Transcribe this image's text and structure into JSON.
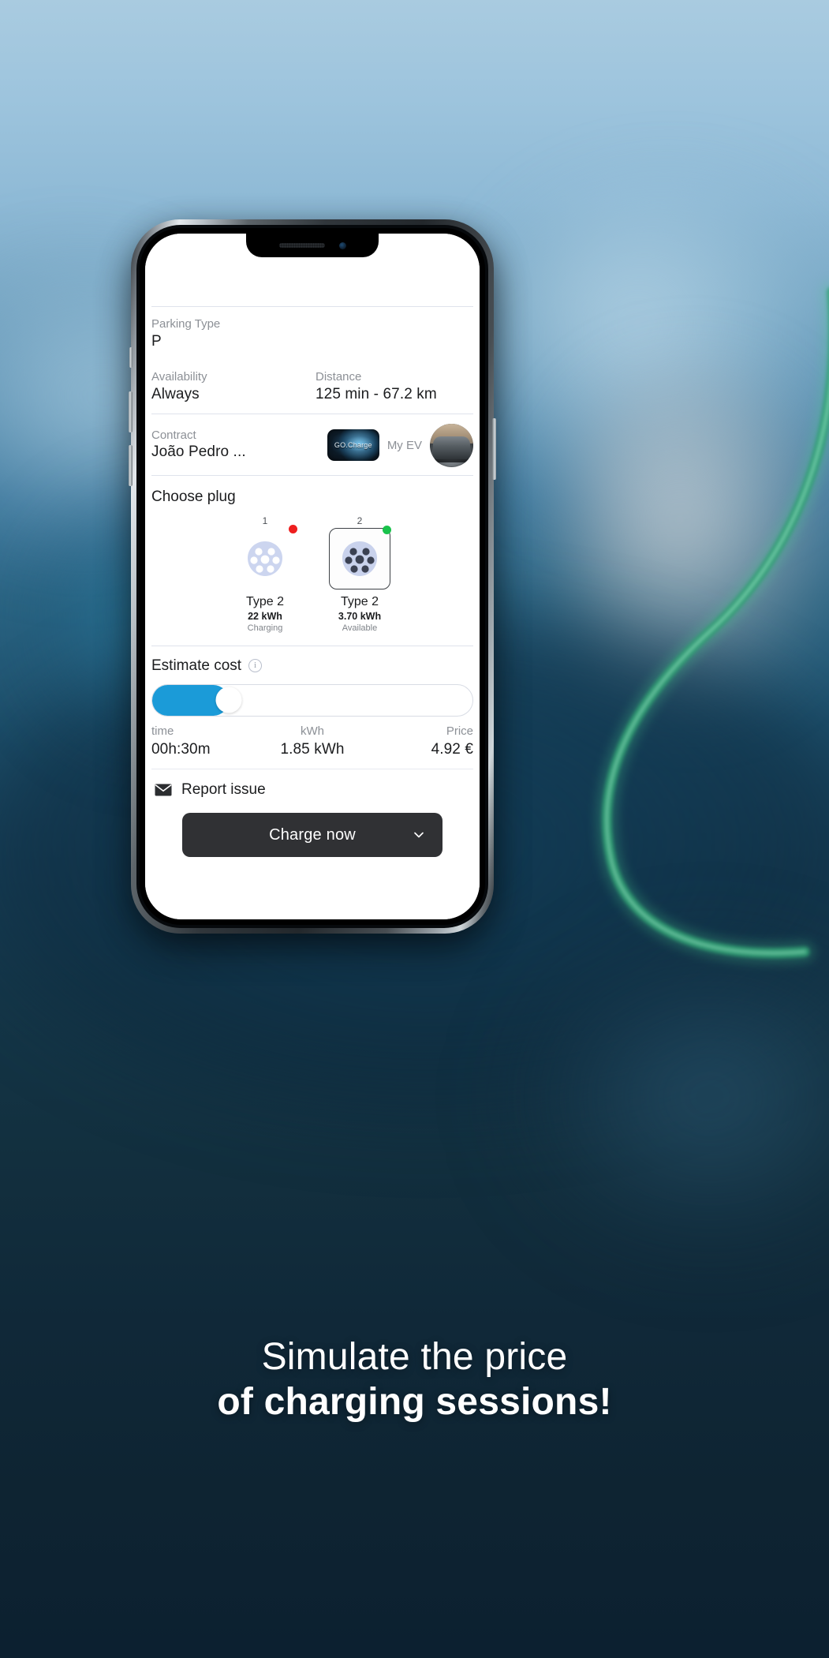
{
  "background": {
    "sky_color": "#a9cbe0",
    "deep_color": "#0e2433",
    "cable_color": "#3fae7a"
  },
  "phone": {
    "status_icons": {
      "speaker": "speaker-grille-icon",
      "camera": "front-camera-icon"
    },
    "side_buttons": [
      "mute-switch",
      "volume-up-button",
      "volume-down-button",
      "power-button"
    ]
  },
  "app": {
    "details": {
      "parking": {
        "label": "Parking Type",
        "value": "P"
      },
      "availability": {
        "label": "Availability",
        "value": "Always"
      },
      "distance": {
        "label": "Distance",
        "value": "125 min - 67.2 km"
      },
      "contract": {
        "label": "Contract",
        "value": "João Pedro ..."
      },
      "provider_badge": "GO.Charge",
      "my_ev": {
        "label": "My EV",
        "avatar": "car-avatar"
      }
    },
    "choose_plug": {
      "title": "Choose plug",
      "plugs": [
        {
          "number": "1",
          "name": "Type 2",
          "power": "22 kWh",
          "state": "Charging",
          "status_color": "#ee1f1f",
          "selected": false
        },
        {
          "number": "2",
          "name": "Type 2",
          "power": "3.70 kWh",
          "state": "Available",
          "status_color": "#19c24b",
          "selected": true
        }
      ]
    },
    "estimate": {
      "title": "Estimate cost",
      "info_icon": "info-icon",
      "slider": {
        "percent": 24,
        "accent": "#1b9bd8",
        "enabled": true
      },
      "time": {
        "label": "time",
        "value": "00h:30m"
      },
      "energy": {
        "label": "kWh",
        "value": "1.85 kWh"
      },
      "price": {
        "label": "Price",
        "value": "4.92 €"
      }
    },
    "report": {
      "label": "Report issue",
      "icon": "envelope-icon"
    },
    "primary_action": {
      "label": "Charge now",
      "icon": "chevron-down-icon",
      "color": "#303134"
    }
  },
  "caption": {
    "line1": "Simulate the price",
    "line2": "of charging sessions!"
  }
}
